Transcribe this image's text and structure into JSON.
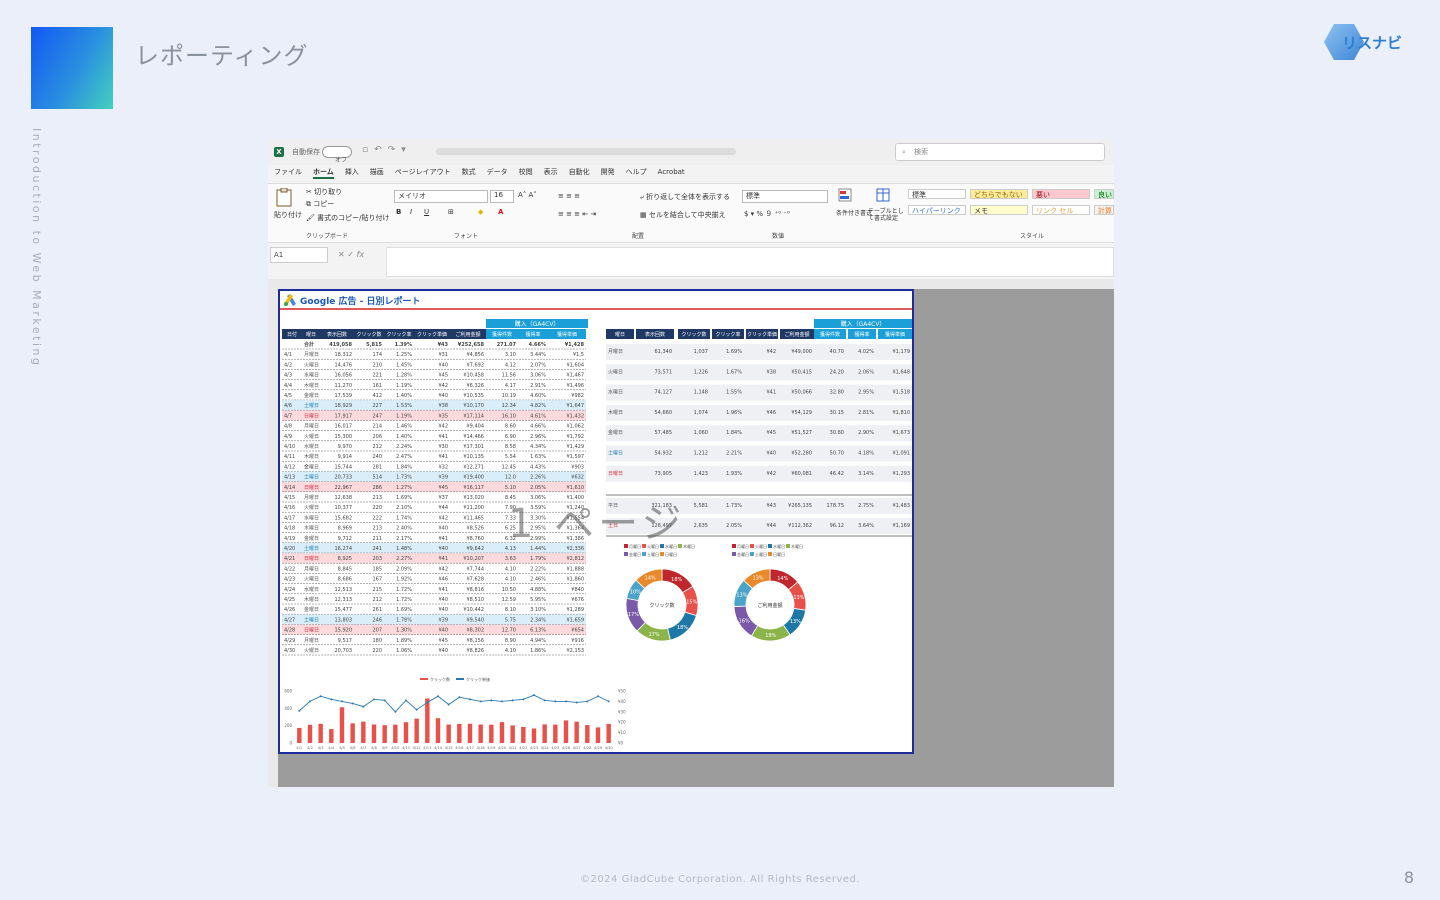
{
  "slide": {
    "title": "レポーティング",
    "vertical_caption": "Introduction to Web Marketing",
    "logo_text": "リスナビ",
    "footer": "©2024 GladCube Corporation. All Rights Reserved.",
    "page_number": "8",
    "colors": {
      "accent_start": "#1258f4",
      "accent_end": "#45d0bc",
      "background": "#eaeff9"
    }
  },
  "excel": {
    "autosave_label": "自動保存",
    "toggle_label": "オフ",
    "search_placeholder": "検索",
    "menu": [
      "ファイル",
      "ホーム",
      "挿入",
      "描画",
      "ページレイアウト",
      "数式",
      "データ",
      "校閲",
      "表示",
      "自動化",
      "開発",
      "ヘルプ",
      "Acrobat"
    ],
    "active_menu": "ホーム",
    "ribbon": {
      "paste": "貼り付け",
      "cut": "切り取り",
      "copy": "コピー",
      "format_painter": "書式のコピー/貼り付け",
      "clipboard": "クリップボード",
      "font_name": "メイリオ",
      "font_size": "16",
      "font_group": "フォント",
      "wrap_text": "折り返して全体を表示する",
      "merge_center": "セルを結合して中央揃え",
      "alignment_group": "配置",
      "number_format": "標準",
      "number_group": "数値",
      "conditional_format": "条件付き書式",
      "table_format": "テーブルとして書式設定",
      "styles_group": "スタイル",
      "styles": [
        {
          "label": "標準",
          "bg": "#ffffff",
          "fg": "#333333"
        },
        {
          "label": "どちらでもない",
          "bg": "#fdeb9c",
          "fg": "#9c6500"
        },
        {
          "label": "悪い",
          "bg": "#ffc7ce",
          "fg": "#9c0006"
        },
        {
          "label": "良い",
          "bg": "#c6efce",
          "fg": "#006100"
        },
        {
          "label": "ハイパーリンク",
          "bg": "#ffffff",
          "fg": "#2e6fd8"
        },
        {
          "label": "メモ",
          "bg": "#ffffcc",
          "fg": "#333333"
        },
        {
          "label": "リンク セル",
          "bg": "#ffffff",
          "fg": "#f29b3a"
        },
        {
          "label": "計算",
          "bg": "#f2f2f2",
          "fg": "#f08020"
        }
      ]
    },
    "name_box": "A1",
    "fx": "fx",
    "sheet": {
      "report_title": "Google 広告 - 日別レポート",
      "watermark": "1 ページ",
      "conversion_header": "購入（GA4CV）",
      "daily_headers": [
        "日付",
        "曜日",
        "表示回数",
        "クリック数",
        "クリック率",
        "クリック単価",
        "ご利用金額",
        "獲得件数",
        "獲得率",
        "獲得単価"
      ],
      "daily_total": [
        "",
        "合計",
        "419,058",
        "5,815",
        "1.39%",
        "¥43",
        "¥252,658",
        "271.07",
        "4.66%",
        "¥1,428"
      ],
      "daily_rows": [
        [
          "4/1",
          "月曜日",
          "18,312",
          "174",
          "1.25%",
          "¥31",
          "¥4,856",
          "3.10",
          "3.44%",
          "¥1,5"
        ],
        [
          "4/2",
          "火曜日",
          "14,476",
          "210",
          "1.45%",
          "¥40",
          "¥7,692",
          "4.12",
          "2.07%",
          "¥1,604"
        ],
        [
          "4/3",
          "水曜日",
          "16,056",
          "221",
          "1.28%",
          "¥45",
          "¥10,458",
          "11.56",
          "3.06%",
          "¥1,467"
        ],
        [
          "4/4",
          "木曜日",
          "11,270",
          "161",
          "1.19%",
          "¥42",
          "¥6,326",
          "4.17",
          "2.91%",
          "¥1,496"
        ],
        [
          "4/5",
          "金曜日",
          "17,539",
          "412",
          "1.40%",
          "¥40",
          "¥10,535",
          "10.19",
          "4.60%",
          "¥982"
        ],
        [
          "4/6",
          "土曜日",
          "18,929",
          "227",
          "1.53%",
          "¥38",
          "¥10,170",
          "12.34",
          "4.82%",
          "¥1,647"
        ],
        [
          "4/7",
          "日曜日",
          "17,917",
          "247",
          "1.19%",
          "¥35",
          "¥17,114",
          "16.10",
          "4.61%",
          "¥1,432"
        ],
        [
          "4/8",
          "月曜日",
          "16,017",
          "214",
          "1.46%",
          "¥42",
          "¥9,404",
          "8.60",
          "4.66%",
          "¥1,062"
        ],
        [
          "4/9",
          "火曜日",
          "15,300",
          "206",
          "1.40%",
          "¥41",
          "¥14,466",
          "6.90",
          "2.96%",
          "¥1,792"
        ],
        [
          "4/10",
          "水曜日",
          "9,970",
          "212",
          "2.24%",
          "¥30",
          "¥17,301",
          "8.58",
          "4.34%",
          "¥1,429"
        ],
        [
          "4/11",
          "木曜日",
          "9,914",
          "240",
          "2.47%",
          "¥41",
          "¥10,135",
          "5.54",
          "1.63%",
          "¥1,597"
        ],
        [
          "4/12",
          "金曜日",
          "15,744",
          "281",
          "1.84%",
          "¥32",
          "¥12,271",
          "12.45",
          "4.43%",
          "¥903"
        ],
        [
          "4/13",
          "土曜日",
          "20,733",
          "514",
          "1.73%",
          "¥39",
          "¥19,400",
          "12.0",
          "2.26%",
          "¥632"
        ],
        [
          "4/14",
          "日曜日",
          "22,967",
          "286",
          "1.27%",
          "¥45",
          "¥16,117",
          "5.10",
          "2.05%",
          "¥1,610"
        ],
        [
          "4/15",
          "月曜日",
          "12,638",
          "213",
          "1.69%",
          "¥37",
          "¥13,020",
          "8.45",
          "3.06%",
          "¥1,400"
        ],
        [
          "4/16",
          "火曜日",
          "10,377",
          "220",
          "2.10%",
          "¥44",
          "¥11,200",
          "7.90",
          "3.59%",
          "¥1,240"
        ],
        [
          "4/17",
          "水曜日",
          "15,682",
          "222",
          "1.74%",
          "¥42",
          "¥11,465",
          "7.33",
          "3.30%",
          "¥1,554"
        ],
        [
          "4/18",
          "木曜日",
          "8,969",
          "213",
          "2.40%",
          "¥40",
          "¥8,526",
          "6.25",
          "2.95%",
          "¥1,364"
        ],
        [
          "4/19",
          "金曜日",
          "9,712",
          "211",
          "2.17%",
          "¥41",
          "¥8,760",
          "6.32",
          "2.99%",
          "¥1,386"
        ],
        [
          "4/20",
          "土曜日",
          "16,274",
          "241",
          "1.48%",
          "¥40",
          "¥9,642",
          "4.13",
          "1.44%",
          "¥2,336"
        ],
        [
          "4/21",
          "日曜日",
          "8,925",
          "203",
          "2.27%",
          "¥41",
          "¥10,207",
          "3.63",
          "1.79%",
          "¥2,812"
        ],
        [
          "4/22",
          "月曜日",
          "8,845",
          "185",
          "2.09%",
          "¥42",
          "¥7,744",
          "4.10",
          "2.22%",
          "¥1,888"
        ],
        [
          "4/23",
          "火曜日",
          "8,686",
          "167",
          "1.92%",
          "¥46",
          "¥7,628",
          "4.10",
          "2.46%",
          "¥1,860"
        ],
        [
          "4/24",
          "水曜日",
          "12,513",
          "215",
          "1.72%",
          "¥41",
          "¥8,816",
          "10.50",
          "4.88%",
          "¥840"
        ],
        [
          "4/25",
          "木曜日",
          "12,313",
          "212",
          "1.72%",
          "¥40",
          "¥8,510",
          "12.59",
          "5.95%",
          "¥676"
        ],
        [
          "4/26",
          "金曜日",
          "15,477",
          "261",
          "1.69%",
          "¥40",
          "¥10,442",
          "8.10",
          "3.10%",
          "¥1,289"
        ],
        [
          "4/27",
          "土曜日",
          "13,803",
          "246",
          "1.78%",
          "¥39",
          "¥9,540",
          "5.75",
          "2.34%",
          "¥1,659"
        ],
        [
          "4/28",
          "日曜日",
          "15,920",
          "207",
          "1.30%",
          "¥40",
          "¥8,302",
          "12.70",
          "6.13%",
          "¥654"
        ],
        [
          "4/29",
          "月曜日",
          "9,517",
          "180",
          "1.89%",
          "¥45",
          "¥8,156",
          "8.90",
          "4.94%",
          "¥916"
        ],
        [
          "4/30",
          "火曜日",
          "20,703",
          "220",
          "1.06%",
          "¥40",
          "¥8,826",
          "4.10",
          "1.86%",
          "¥2,153"
        ]
      ],
      "weekday_headers": [
        "曜日",
        "表示回数",
        "クリック数",
        "クリック率",
        "クリック単価",
        "ご利用金額",
        "獲得件数",
        "獲得率",
        "獲得単価"
      ],
      "weekday_rows": [
        [
          "月曜日",
          "61,340",
          "1,037",
          "1.69%",
          "¥42",
          "¥49,000",
          "40.70",
          "4.02%",
          "¥1,179"
        ],
        [
          "火曜日",
          "73,571",
          "1,226",
          "1.67%",
          "¥38",
          "¥50,415",
          "24.20",
          "2.06%",
          "¥1,648"
        ],
        [
          "水曜日",
          "74,127",
          "1,148",
          "1.55%",
          "¥41",
          "¥50,066",
          "32.80",
          "2.95%",
          "¥1,518"
        ],
        [
          "木曜日",
          "54,660",
          "1,074",
          "1.96%",
          "¥46",
          "¥54,129",
          "30.15",
          "2.81%",
          "¥1,810"
        ],
        [
          "金曜日",
          "57,485",
          "1,060",
          "1.84%",
          "¥45",
          "¥51,527",
          "30.80",
          "2.90%",
          "¥1,673"
        ],
        [
          "土曜日",
          "54,932",
          "1,212",
          "2.21%",
          "¥40",
          "¥52,280",
          "50.70",
          "4.18%",
          "¥1,091"
        ],
        [
          "日曜日",
          "73,905",
          "1,423",
          "1.93%",
          "¥42",
          "¥60,081",
          "46.42",
          "3.14%",
          "¥1,293"
        ]
      ],
      "weekday_total_rows": [
        [
          "平日",
          "321,183",
          "5,581",
          "1.73%",
          "¥43",
          "¥265,135",
          "178.75",
          "2.75%",
          "¥1,483"
        ],
        [
          "土日",
          "128,497",
          "2,635",
          "2.05%",
          "¥44",
          "¥112,362",
          "96.12",
          "3.64%",
          "¥1,169"
        ]
      ],
      "donut_legend": [
        "月曜日",
        "火曜日",
        "水曜日",
        "木曜日",
        "金曜日",
        "土曜日",
        "日曜日"
      ],
      "donut_charts": [
        {
          "center": "クリック数",
          "colors": [
            "#c0272d",
            "#e8514a",
            "#1d78a8",
            "#8bb54a",
            "#7a5aa8",
            "#4ba3c8",
            "#e88a2a"
          ],
          "values": [
            17.8,
            14.6,
            18.0,
            17.3,
            17.2,
            10.0,
            14.0
          ],
          "labels": [
            "18%",
            "15%",
            "18%",
            "17%",
            "17%",
            "10%",
            "14%"
          ]
        },
        {
          "center": "ご利用金額",
          "colors": [
            "#c0272d",
            "#e8514a",
            "#1d78a8",
            "#8bb54a",
            "#7a5aa8",
            "#4ba3c8",
            "#e88a2a"
          ],
          "values": [
            14.0,
            13.3,
            13.3,
            18.0,
            15.7,
            12.7,
            13.0
          ],
          "labels": [
            "14%",
            "13%",
            "13%",
            "18%",
            "16%",
            "13%",
            "13%"
          ]
        }
      ],
      "combo_legend": [
        "クリック数",
        "クリック単価"
      ],
      "chart_data": {
        "type": "bar",
        "categories": [
          "4/1",
          "4/2",
          "4/3",
          "4/4",
          "4/5",
          "4/6",
          "4/7",
          "4/8",
          "4/9",
          "4/10",
          "4/11",
          "4/12",
          "4/13",
          "4/14",
          "4/15",
          "4/16",
          "4/17",
          "4/18",
          "4/19",
          "4/20",
          "4/21",
          "4/22",
          "4/23",
          "4/24",
          "4/25",
          "4/26",
          "4/27",
          "4/28",
          "4/29",
          "4/30"
        ],
        "series": [
          {
            "name": "クリック数",
            "type": "bar",
            "axis": "left",
            "color": "#e8514a",
            "values": [
              174,
              210,
              221,
              161,
              412,
              227,
              247,
              214,
              206,
              212,
              240,
              281,
              514,
              286,
              213,
              220,
              222,
              213,
              211,
              241,
              203,
              185,
              167,
              215,
              212,
              261,
              246,
              207,
              180,
              220
            ]
          },
          {
            "name": "クリック単価",
            "type": "line",
            "axis": "right",
            "color": "#2a7ab0",
            "values": [
              31,
              40,
              45,
              42,
              40,
              38,
              35,
              42,
              41,
              30,
              41,
              32,
              39,
              45,
              37,
              44,
              42,
              40,
              41,
              40,
              41,
              42,
              46,
              41,
              40,
              40,
              39,
              40,
              45,
              40
            ]
          }
        ],
        "ylim": [
          0,
          600
        ],
        "y2lim": [
          0,
          50
        ]
      }
    }
  }
}
